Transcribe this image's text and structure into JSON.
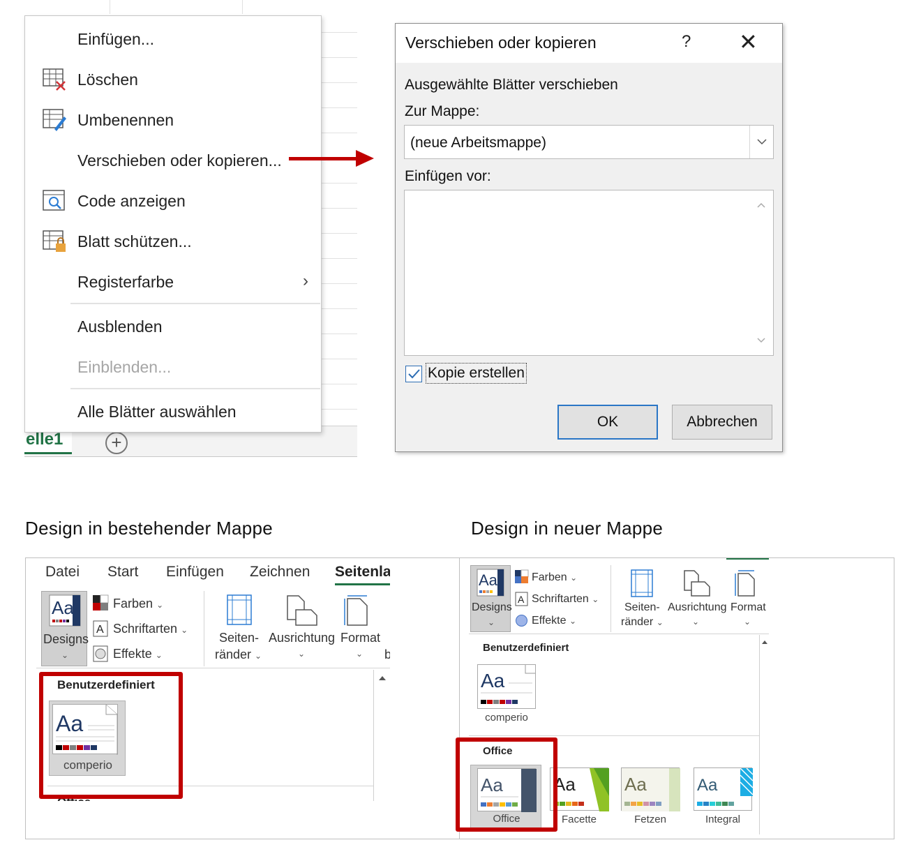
{
  "context_menu": {
    "items": [
      {
        "label": "Einfügen...",
        "icon": "",
        "disabled": false
      },
      {
        "label": "Löschen",
        "icon": "delete-sheet-icon",
        "disabled": false
      },
      {
        "label": "Umbenennen",
        "icon": "rename-sheet-icon",
        "disabled": false
      },
      {
        "label": "Verschieben oder kopieren...",
        "icon": "",
        "disabled": false
      },
      {
        "label": "Code anzeigen",
        "icon": "view-code-icon",
        "disabled": false
      },
      {
        "label": "Blatt schützen...",
        "icon": "protect-sheet-icon",
        "disabled": false
      },
      {
        "label": "Registerfarbe",
        "icon": "",
        "disabled": false,
        "submenu": true
      },
      {
        "label": "Ausblenden",
        "icon": "",
        "disabled": false
      },
      {
        "label": "Einblenden...",
        "icon": "",
        "disabled": true
      },
      {
        "label": "Alle Blätter auswählen",
        "icon": "",
        "disabled": false
      }
    ]
  },
  "sheet_tabs": {
    "active_tab": "elle1",
    "add_symbol": "+"
  },
  "dialog": {
    "title": "Verschieben oder kopieren",
    "help": "?",
    "close": "✕",
    "move_label": "Ausgewählte Blätter verschieben",
    "to_book_label": "Zur Mappe:",
    "to_book_value": "(neue Arbeitsmappe)",
    "insert_before_label": "Einfügen vor:",
    "copy_checkbox_label": "Kopie erstellen",
    "copy_checked": true,
    "ok_label": "OK",
    "cancel_label": "Abbrechen"
  },
  "headings": {
    "left": "Design in bestehender Mappe",
    "right": "Design in neuer Mappe"
  },
  "ribbon_left": {
    "tabs": [
      "Datei",
      "Start",
      "Einfügen",
      "Zeichnen",
      "Seitenlay"
    ],
    "designs_label": "Designs",
    "farben": "Farben",
    "schriftarten": "Schriftarten",
    "effekte": "Effekte",
    "seiten_1": "Seiten-",
    "seiten_2": "ränder",
    "ausrichtung": "Ausrichtung",
    "format": "Format",
    "cut_letter": "b",
    "gallery_header": "Benutzerdefiniert",
    "custom_theme": "comperio",
    "next_header": "Office"
  },
  "ribbon_right": {
    "designs_label": "Designs",
    "farben": "Farben",
    "schriftarten": "Schriftarten",
    "effekte": "Effekte",
    "seiten_1": "Seiten-",
    "seiten_2": "ränder",
    "ausrichtung": "Ausrichtung",
    "format": "Format",
    "gallery_header_custom": "Benutzerdefiniert",
    "custom_theme": "comperio",
    "gallery_header_office": "Office",
    "office_themes": [
      "Office",
      "Facette",
      "Fetzen",
      "Integral"
    ]
  },
  "colors": {
    "excel_green": "#217346",
    "highlight_red": "#c00000",
    "dialog_bg": "#f0f0f0",
    "primary_button_border": "#2a76c6",
    "theme_swatch": [
      "#000000",
      "#c00000",
      "#7f7f7f",
      "#c00000",
      "#7030a0",
      "#1f3864"
    ],
    "office_swatch": [
      "#4472c4",
      "#ed7d31",
      "#a5a5a5",
      "#ffc000",
      "#5b9bd5",
      "#70ad47"
    ],
    "facette_swatch": [
      "#90c226",
      "#54a021",
      "#e6b91e",
      "#e76618",
      "#c42f1a",
      "#918655"
    ],
    "fetzen_swatch": [
      "#a5b592",
      "#f3a447",
      "#e7bc29",
      "#d092a7",
      "#9c85c0",
      "#809ec2"
    ],
    "integral_swatch": [
      "#1cade4",
      "#2683c6",
      "#27ced7",
      "#42ba97",
      "#3e8853",
      "#62a39f"
    ]
  }
}
